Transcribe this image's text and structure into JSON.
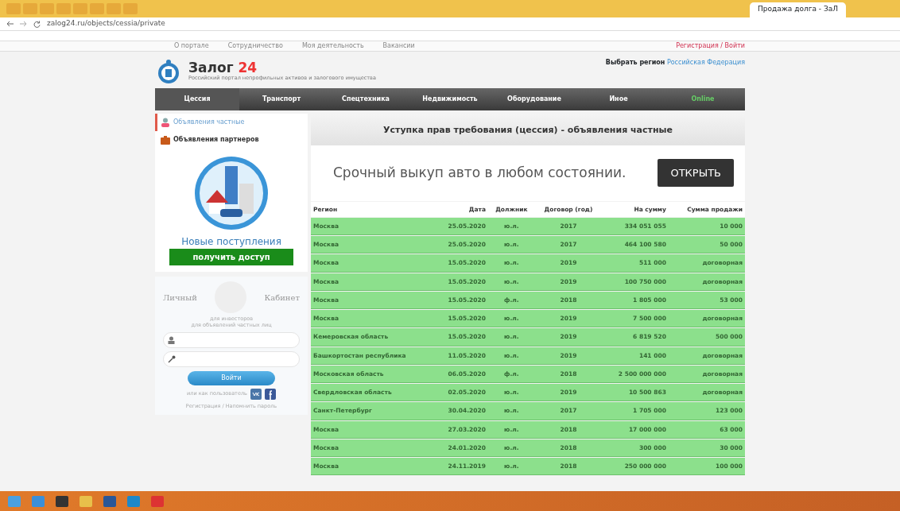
{
  "browser": {
    "tabs": [
      {
        "title": "Продажа долга - ЗаЛ",
        "selected": true
      }
    ],
    "url": "zalog24.ru/objects/cessia/private"
  },
  "site_topbar": {
    "links": [
      "О портале",
      "Сотрудничество",
      "Моя деятельность",
      "Вакансии"
    ],
    "auth": "Регистрация / Войти"
  },
  "header": {
    "brand": "Залог",
    "brand_accent": "24",
    "tagline": "Российский портал непрофильных активов и залогового имущества",
    "region_label": "Выбрать регион",
    "region_link": "Российская Федерация"
  },
  "nav": [
    {
      "label": "Цессия",
      "selected": true,
      "kind": "normal"
    },
    {
      "label": "Транспорт",
      "selected": false,
      "kind": "normal"
    },
    {
      "label": "Спецтехника",
      "selected": false,
      "kind": "normal"
    },
    {
      "label": "Недвижимость",
      "selected": false,
      "kind": "normal"
    },
    {
      "label": "Оборудование",
      "selected": false,
      "kind": "normal"
    },
    {
      "label": "Иное",
      "selected": false,
      "kind": "normal"
    },
    {
      "label": "Online",
      "selected": false,
      "kind": "accent"
    }
  ],
  "sidebar": {
    "menu": [
      {
        "label": "Объявления частные",
        "selected": true,
        "kind": "person"
      },
      {
        "label": "Объявления партнеров",
        "selected": false,
        "kind": "briefcase"
      }
    ],
    "promo": {
      "title": "Новые поступления",
      "button": "получить доступ"
    },
    "login": {
      "title_left": "Личный",
      "title_right": "Кабинет",
      "note": [
        "для инвесторов",
        "для объявлений частных лиц"
      ],
      "fields": [
        {
          "kind": "user"
        },
        {
          "kind": "password"
        }
      ],
      "button": "Войти",
      "social_text": "или как пользователь",
      "footer_link": "Регистрация / Напомнить пароль"
    }
  },
  "main": {
    "title": "Уступка прав требования (цессия) - объявления частные",
    "ad": {
      "text": "Срочный выкуп авто в любом состоянии.",
      "button": "ОТКРЫТЬ"
    },
    "table": {
      "columns": [
        "Регион",
        "Дата",
        "Должник",
        "Договор (год)",
        "На сумму",
        "Сумма продажи"
      ],
      "rows": [
        [
          "Москва",
          "25.05.2020",
          "ю.л.",
          "2017",
          "334 051 055",
          "10 000"
        ],
        [
          "Москва",
          "25.05.2020",
          "ю.л.",
          "2017",
          "464 100 580",
          "50 000"
        ],
        [
          "Москва",
          "15.05.2020",
          "ю.л.",
          "2019",
          "511 000",
          "договорная"
        ],
        [
          "Москва",
          "15.05.2020",
          "ю.л.",
          "2019",
          "100 750 000",
          "договорная"
        ],
        [
          "Москва",
          "15.05.2020",
          "ф.л.",
          "2018",
          "1 805 000",
          "53 000"
        ],
        [
          "Москва",
          "15.05.2020",
          "ю.л.",
          "2019",
          "7 500 000",
          "договорная"
        ],
        [
          "Кемеровская область",
          "15.05.2020",
          "ю.л.",
          "2019",
          "6 819 520",
          "500 000"
        ],
        [
          "Башкортостан республика",
          "11.05.2020",
          "ю.л.",
          "2019",
          "141 000",
          "договорная"
        ],
        [
          "Московская область",
          "06.05.2020",
          "ф.л.",
          "2018",
          "2 500 000 000",
          "договорная"
        ],
        [
          "Свердловская область",
          "02.05.2020",
          "ю.л.",
          "2019",
          "10 500 863",
          "договорная"
        ],
        [
          "Санкт-Петербург",
          "30.04.2020",
          "ю.л.",
          "2017",
          "1 705 000",
          "123 000"
        ],
        [
          "Москва",
          "27.03.2020",
          "ю.л.",
          "2018",
          "17 000 000",
          "63 000"
        ],
        [
          "Москва",
          "24.01.2020",
          "ю.л.",
          "2018",
          "300 000",
          "30 000"
        ],
        [
          "Москва",
          "24.11.2019",
          "ю.л.",
          "2018",
          "250 000 000",
          "100 000"
        ]
      ]
    }
  }
}
